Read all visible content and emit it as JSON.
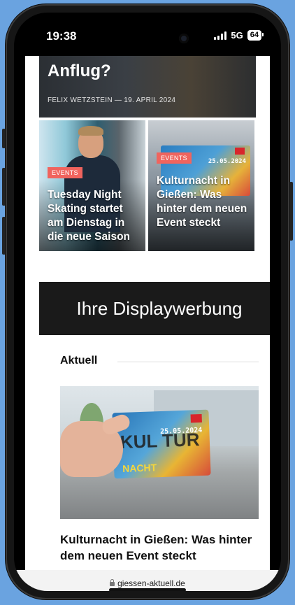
{
  "status_bar": {
    "time": "19:38",
    "network": "5G",
    "battery": "64"
  },
  "hero": {
    "title": "Anflug?",
    "meta": "FELIX WETZSTEIN — 19. APRIL 2024"
  },
  "cards": [
    {
      "tag": "EVENTS",
      "title": "Tuesday Night Skating startet am Dienstag in die neue Saison"
    },
    {
      "tag": "EVENTS",
      "title": "Kulturnacht in Gießen: Was hinter dem neuen Event steckt",
      "flyer_date": "25.05.2024"
    }
  ],
  "ad": {
    "text": "Ihre Displaywerbung"
  },
  "section": {
    "label": "Aktuell"
  },
  "article": {
    "flyer_date": "25.05.2024",
    "flyer_word": "KUL TUR",
    "flyer_nacht": "NACHT",
    "title": "Kulturnacht in Gießen: Was hinter dem neuen Event steckt"
  },
  "browser": {
    "url": "giessen-aktuell.de"
  }
}
